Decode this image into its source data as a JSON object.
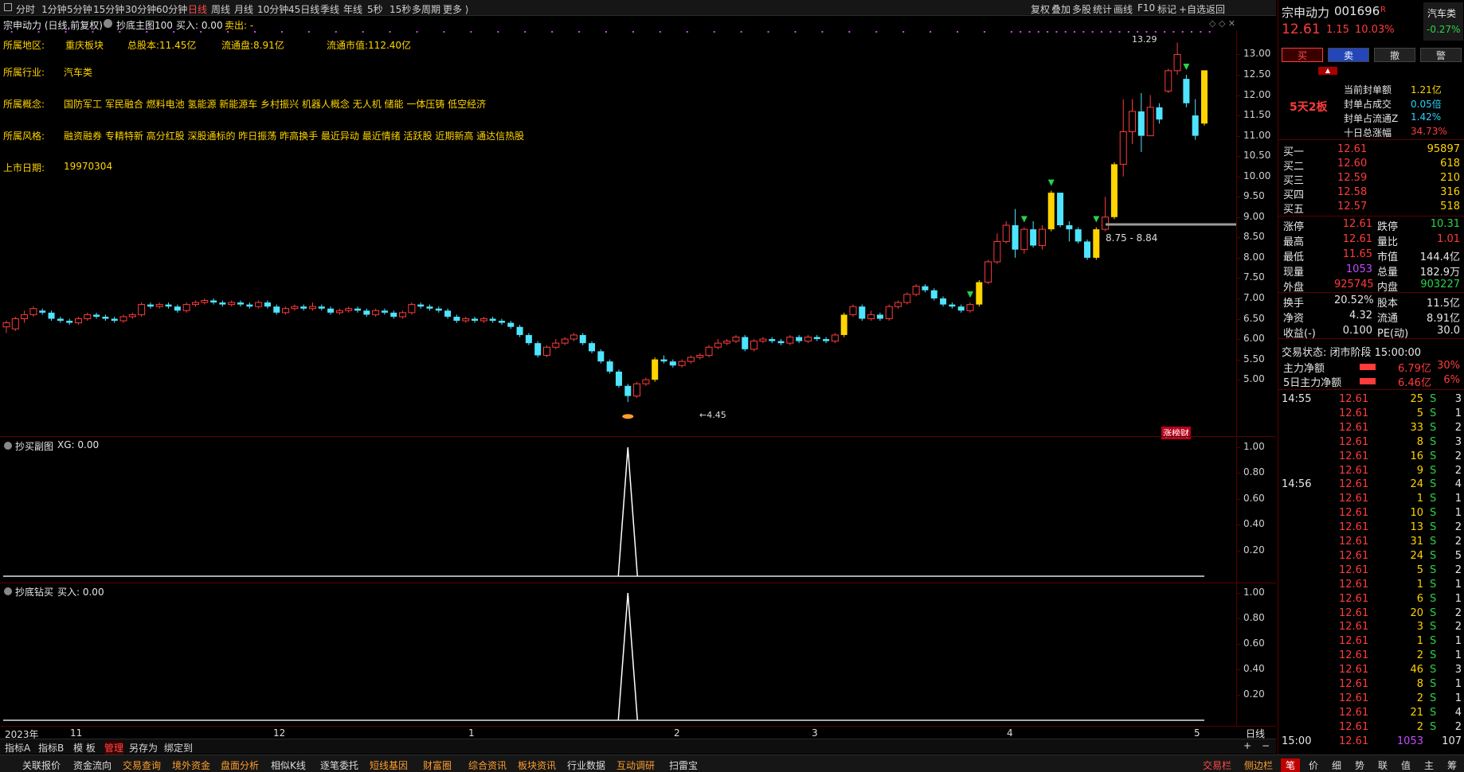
{
  "toolbar": {
    "items": [
      "分时",
      "1分钟",
      "5分钟",
      "15分钟",
      "30分钟",
      "60分钟",
      "日线",
      "周线",
      "月线",
      "10分钟",
      "45日线",
      "季线",
      "年线",
      "5秒",
      "15秒",
      "多周期",
      "更多 ⟩"
    ],
    "active": "日线",
    "right_items": [
      "复权",
      "叠加",
      "多股",
      "统计",
      "画线",
      "F10",
      "标记",
      "+自选",
      "返回"
    ]
  },
  "chart": {
    "title": "宗申动力 (日线,前复权)",
    "indicator_name": "抄底主图100",
    "buy_label": "买入: 0.00",
    "sell_label": "卖出: -",
    "info": {
      "region_label": "所属地区:",
      "region_value": "重庆板块",
      "total_share": "总股本:11.45亿",
      "float_share": "流通盘:8.91亿",
      "float_mcap": "流通市值:112.40亿",
      "industry_label": "所属行业:",
      "industry_value": "汽车类",
      "concept_label": "所属概念:",
      "concept_value": "国防军工 军民融合 燃料电池 氢能源 新能源车 乡村振兴 机器人概念 无人机 储能 一体压铸 低空经济",
      "style_label": "所属风格:",
      "style_value": "融资融券 专精特新 高分红股 深股通标的 昨日振荡 昨高换手 最近异动 最近情绪 活跃股 近期新高 通达信热股",
      "list_label": "上市日期:",
      "list_value": "19970304"
    },
    "y_ticks": [
      "13.00",
      "12.50",
      "12.00",
      "11.50",
      "11.00",
      "10.50",
      "10.00",
      "9.50",
      "9.00",
      "8.50",
      "8.00",
      "7.50",
      "7.00",
      "6.50",
      "6.00",
      "5.50",
      "5.00"
    ],
    "high_marker": "13.29",
    "low_marker": "←4.45",
    "range_label": "8.75 - 8.84",
    "badge": "涨榜财",
    "x_labels": [
      "2023年",
      "11",
      "12",
      "1",
      "2",
      "3",
      "4",
      "5"
    ],
    "period": "日线"
  },
  "chart_data": {
    "type": "candlestick",
    "ylim": [
      4.2,
      13.4
    ],
    "candles": [
      [
        6.3,
        6.4,
        6.15,
        6.45
      ],
      [
        6.25,
        6.5,
        6.2,
        6.55
      ],
      [
        6.5,
        6.6,
        6.4,
        6.7
      ],
      [
        6.6,
        6.75,
        6.55,
        6.8
      ],
      [
        6.7,
        6.65,
        6.6,
        6.75
      ],
      [
        6.65,
        6.5,
        6.45,
        6.7
      ],
      [
        6.5,
        6.45,
        6.4,
        6.55
      ],
      [
        6.45,
        6.4,
        6.35,
        6.5
      ],
      [
        6.4,
        6.5,
        6.35,
        6.55
      ],
      [
        6.5,
        6.6,
        6.45,
        6.65
      ],
      [
        6.6,
        6.55,
        6.5,
        6.65
      ],
      [
        6.55,
        6.5,
        6.45,
        6.6
      ],
      [
        6.5,
        6.45,
        6.4,
        6.55
      ],
      [
        6.45,
        6.55,
        6.4,
        6.6
      ],
      [
        6.55,
        6.6,
        6.5,
        6.65
      ],
      [
        6.6,
        6.85,
        6.55,
        6.9
      ],
      [
        6.85,
        6.8,
        6.75,
        6.9
      ],
      [
        6.8,
        6.85,
        6.75,
        6.9
      ],
      [
        6.85,
        6.8,
        6.75,
        6.9
      ],
      [
        6.8,
        6.7,
        6.65,
        6.85
      ],
      [
        6.7,
        6.85,
        6.65,
        6.9
      ],
      [
        6.85,
        6.9,
        6.8,
        6.95
      ],
      [
        6.9,
        6.95,
        6.85,
        7.0
      ],
      [
        6.95,
        6.9,
        6.85,
        7.0
      ],
      [
        6.9,
        6.85,
        6.8,
        6.95
      ],
      [
        6.85,
        6.9,
        6.8,
        6.95
      ],
      [
        6.9,
        6.85,
        6.8,
        6.95
      ],
      [
        6.85,
        6.8,
        6.75,
        6.9
      ],
      [
        6.8,
        6.9,
        6.75,
        6.95
      ],
      [
        6.9,
        6.8,
        6.75,
        6.95
      ],
      [
        6.8,
        6.65,
        6.6,
        6.85
      ],
      [
        6.65,
        6.75,
        6.6,
        6.8
      ],
      [
        6.75,
        6.8,
        6.7,
        6.85
      ],
      [
        6.8,
        6.75,
        6.7,
        6.85
      ],
      [
        6.75,
        6.8,
        6.7,
        6.9
      ],
      [
        6.8,
        6.75,
        6.7,
        6.85
      ],
      [
        6.75,
        6.65,
        6.6,
        6.8
      ],
      [
        6.65,
        6.7,
        6.6,
        6.75
      ],
      [
        6.7,
        6.75,
        6.65,
        6.8
      ],
      [
        6.75,
        6.7,
        6.65,
        6.8
      ],
      [
        6.7,
        6.6,
        6.55,
        6.75
      ],
      [
        6.6,
        6.7,
        6.55,
        6.75
      ],
      [
        6.7,
        6.65,
        6.6,
        6.75
      ],
      [
        6.65,
        6.55,
        6.5,
        6.7
      ],
      [
        6.55,
        6.65,
        6.5,
        6.7
      ],
      [
        6.65,
        6.85,
        6.6,
        6.9
      ],
      [
        6.85,
        6.8,
        6.75,
        6.9
      ],
      [
        6.8,
        6.75,
        6.7,
        6.85
      ],
      [
        6.75,
        6.7,
        6.65,
        6.8
      ],
      [
        6.7,
        6.55,
        6.5,
        6.75
      ],
      [
        6.55,
        6.45,
        6.4,
        6.6
      ],
      [
        6.45,
        6.5,
        6.4,
        6.55
      ],
      [
        6.5,
        6.45,
        6.4,
        6.55
      ],
      [
        6.45,
        6.5,
        6.4,
        6.55
      ],
      [
        6.5,
        6.45,
        6.4,
        6.55
      ],
      [
        6.45,
        6.4,
        6.35,
        6.5
      ],
      [
        6.4,
        6.3,
        6.25,
        6.45
      ],
      [
        6.3,
        6.1,
        6.05,
        6.35
      ],
      [
        6.1,
        5.9,
        5.85,
        6.15
      ],
      [
        5.9,
        5.6,
        5.55,
        5.95
      ],
      [
        5.6,
        5.8,
        5.55,
        5.85
      ],
      [
        5.8,
        5.9,
        5.75,
        6.0
      ],
      [
        5.9,
        6.0,
        5.85,
        6.05
      ],
      [
        6.0,
        6.1,
        5.95,
        6.15
      ],
      [
        6.1,
        5.9,
        5.85,
        6.15
      ],
      [
        5.9,
        5.7,
        5.65,
        5.95
      ],
      [
        5.7,
        5.45,
        5.4,
        5.75
      ],
      [
        5.45,
        5.2,
        5.15,
        5.5
      ],
      [
        5.2,
        4.85,
        4.8,
        5.25
      ],
      [
        4.85,
        4.6,
        4.45,
        4.9
      ],
      [
        4.6,
        4.9,
        4.55,
        4.95
      ],
      [
        4.9,
        5.0,
        4.85,
        5.05
      ],
      [
        5.0,
        5.5,
        4.95,
        5.55
      ],
      [
        5.5,
        5.45,
        5.4,
        5.6
      ],
      [
        5.45,
        5.35,
        5.3,
        5.5
      ],
      [
        5.35,
        5.45,
        5.3,
        5.5
      ],
      [
        5.45,
        5.55,
        5.4,
        5.6
      ],
      [
        5.55,
        5.6,
        5.5,
        5.65
      ],
      [
        5.6,
        5.8,
        5.55,
        5.85
      ],
      [
        5.8,
        5.9,
        5.75,
        6.0
      ],
      [
        5.9,
        5.95,
        5.85,
        6.0
      ],
      [
        5.95,
        6.05,
        5.9,
        6.1
      ],
      [
        6.05,
        5.75,
        5.7,
        6.1
      ],
      [
        5.75,
        5.95,
        5.7,
        6.0
      ],
      [
        5.95,
        6.0,
        5.9,
        6.05
      ],
      [
        6.0,
        5.95,
        5.9,
        6.05
      ],
      [
        5.95,
        5.9,
        5.85,
        6.0
      ],
      [
        5.9,
        6.05,
        5.85,
        6.1
      ],
      [
        6.05,
        5.95,
        5.9,
        6.1
      ],
      [
        5.95,
        6.05,
        5.9,
        6.1
      ],
      [
        6.05,
        6.0,
        5.95,
        6.1
      ],
      [
        6.0,
        5.95,
        5.9,
        6.05
      ],
      [
        5.95,
        6.1,
        5.9,
        6.15
      ],
      [
        6.1,
        6.6,
        6.05,
        6.65
      ],
      [
        6.6,
        6.8,
        6.55,
        6.85
      ],
      [
        6.8,
        6.5,
        6.45,
        6.85
      ],
      [
        6.5,
        6.6,
        6.45,
        6.7
      ],
      [
        6.6,
        6.5,
        6.45,
        6.65
      ],
      [
        6.5,
        6.8,
        6.45,
        6.85
      ],
      [
        6.8,
        6.9,
        6.75,
        6.95
      ],
      [
        6.9,
        7.1,
        6.85,
        7.15
      ],
      [
        7.1,
        7.3,
        7.05,
        7.35
      ],
      [
        7.3,
        7.2,
        7.15,
        7.35
      ],
      [
        7.2,
        7.0,
        6.95,
        7.25
      ],
      [
        7.0,
        6.85,
        6.8,
        7.05
      ],
      [
        6.85,
        6.8,
        6.75,
        6.9
      ],
      [
        6.8,
        6.7,
        6.65,
        6.85
      ],
      [
        6.7,
        6.85,
        6.65,
        6.9
      ],
      [
        6.85,
        7.4,
        6.8,
        7.45
      ],
      [
        7.4,
        7.9,
        7.35,
        7.95
      ],
      [
        7.9,
        8.4,
        7.85,
        8.6
      ],
      [
        8.4,
        8.8,
        8.35,
        8.9
      ],
      [
        8.8,
        8.2,
        8.0,
        9.2
      ],
      [
        8.2,
        8.7,
        8.1,
        8.75
      ],
      [
        8.7,
        8.3,
        8.25,
        8.9
      ],
      [
        8.3,
        8.7,
        8.2,
        8.8
      ],
      [
        8.7,
        9.6,
        8.65,
        9.65
      ],
      [
        9.6,
        8.8,
        8.75,
        9.25
      ],
      [
        8.8,
        8.7,
        8.4,
        8.9
      ],
      [
        8.7,
        8.4,
        8.35,
        8.75
      ],
      [
        8.4,
        8.0,
        7.95,
        8.45
      ],
      [
        8.0,
        8.7,
        7.95,
        8.75
      ],
      [
        8.7,
        9.0,
        8.65,
        9.5
      ],
      [
        9.0,
        10.3,
        8.95,
        10.35
      ],
      [
        10.3,
        11.1,
        10.0,
        11.9
      ],
      [
        11.1,
        11.6,
        10.8,
        11.9
      ],
      [
        11.6,
        11.0,
        10.6,
        12.05
      ],
      [
        11.0,
        11.7,
        11.0,
        12.0
      ],
      [
        11.7,
        11.4,
        11.3,
        11.8
      ],
      [
        12.1,
        12.6,
        12.05,
        12.65
      ],
      [
        12.6,
        13.0,
        12.5,
        13.29
      ],
      [
        12.4,
        11.8,
        11.7,
        12.5
      ],
      [
        11.5,
        11.0,
        10.9,
        11.9
      ],
      [
        11.3,
        12.61,
        11.25,
        12.61
      ]
    ]
  },
  "panel2": {
    "title": "抄买副图",
    "value": "XG: 0.00",
    "ticks": [
      "1.00",
      "0.80",
      "0.60",
      "0.40",
      "0.20"
    ]
  },
  "panel3": {
    "title": "抄底钻买",
    "value": "买入: 0.00",
    "ticks": [
      "1.00",
      "0.80",
      "0.60",
      "0.40",
      "0.20"
    ]
  },
  "tabs": {
    "items": [
      "指标A",
      "指标B",
      "模 板",
      "管理",
      "另存为",
      "绑定到"
    ],
    "active": "管理",
    "zoom_plus": "+",
    "zoom_minus": "−"
  },
  "bottom": {
    "items": [
      "关联报价",
      "资金流向",
      "交易查询",
      "境外资金",
      "盘面分析",
      "相似K线",
      "逐笔委托",
      "短线基因",
      "财富圈",
      "综合资讯",
      "板块资讯",
      "行业数据",
      "互动调研",
      "扫雷宝"
    ],
    "right": [
      "交易栏",
      "侧边栏"
    ]
  },
  "right": {
    "name": "宗申动力",
    "code": "001696",
    "tag": "R",
    "sector": "汽车类",
    "sector_pct": "-0.27%",
    "price": "12.61",
    "change": "1.15",
    "pct": "10.03%",
    "actions": [
      "买",
      "卖",
      "撤",
      "警"
    ],
    "board": "5天2板",
    "seal": [
      {
        "label": "当前封单额",
        "value": "1.21亿"
      },
      {
        "label": "封单占成交",
        "value": "0.05倍"
      },
      {
        "label": "封单占流通Z",
        "value": "1.42%"
      },
      {
        "label": "十日总涨幅",
        "value": "34.73%"
      }
    ],
    "bids": [
      {
        "name": "买一",
        "price": "12.61",
        "vol": "95897"
      },
      {
        "name": "买二",
        "price": "12.60",
        "vol": "618"
      },
      {
        "name": "买三",
        "price": "12.59",
        "vol": "210"
      },
      {
        "name": "买四",
        "price": "12.58",
        "vol": "316"
      },
      {
        "name": "买五",
        "price": "12.57",
        "vol": "518"
      }
    ],
    "stats": [
      [
        "涨停",
        "12.61",
        "跌停",
        "10.31"
      ],
      [
        "最高",
        "12.61",
        "量比",
        "1.01"
      ],
      [
        "最低",
        "11.65",
        "市值",
        "144.4亿"
      ],
      [
        "现量",
        "1053",
        "总量",
        "182.9万"
      ],
      [
        "外盘",
        "925745",
        "内盘",
        "903227"
      ]
    ],
    "stats2": [
      [
        "换手",
        "20.52%",
        "股本",
        "11.5亿"
      ],
      [
        "净资",
        "4.32",
        "流通",
        "8.91亿"
      ],
      [
        "收益(-)",
        "0.100",
        "PE(动)",
        "30.0"
      ]
    ],
    "status": "交易状态: 闭市阶段 15:00:00",
    "flows": [
      {
        "label": "主力净额",
        "value": "6.79亿",
        "pct": "30%"
      },
      {
        "label": "5日主力净额",
        "value": "6.46亿",
        "pct": "6%"
      }
    ],
    "trades": [
      {
        "t": "14:55",
        "p": "12.61",
        "v": "25",
        "s": "S",
        "n": "3"
      },
      {
        "t": "",
        "p": "12.61",
        "v": "5",
        "s": "S",
        "n": "1"
      },
      {
        "t": "",
        "p": "12.61",
        "v": "33",
        "s": "S",
        "n": "2"
      },
      {
        "t": "",
        "p": "12.61",
        "v": "8",
        "s": "S",
        "n": "3"
      },
      {
        "t": "",
        "p": "12.61",
        "v": "16",
        "s": "S",
        "n": "2"
      },
      {
        "t": "",
        "p": "12.61",
        "v": "9",
        "s": "S",
        "n": "2"
      },
      {
        "t": "14:56",
        "p": "12.61",
        "v": "24",
        "s": "S",
        "n": "4"
      },
      {
        "t": "",
        "p": "12.61",
        "v": "1",
        "s": "S",
        "n": "1"
      },
      {
        "t": "",
        "p": "12.61",
        "v": "10",
        "s": "S",
        "n": "1"
      },
      {
        "t": "",
        "p": "12.61",
        "v": "13",
        "s": "S",
        "n": "2"
      },
      {
        "t": "",
        "p": "12.61",
        "v": "31",
        "s": "S",
        "n": "2"
      },
      {
        "t": "",
        "p": "12.61",
        "v": "24",
        "s": "S",
        "n": "5"
      },
      {
        "t": "",
        "p": "12.61",
        "v": "5",
        "s": "S",
        "n": "2"
      },
      {
        "t": "",
        "p": "12.61",
        "v": "1",
        "s": "S",
        "n": "1"
      },
      {
        "t": "",
        "p": "12.61",
        "v": "6",
        "s": "S",
        "n": "1"
      },
      {
        "t": "",
        "p": "12.61",
        "v": "20",
        "s": "S",
        "n": "2"
      },
      {
        "t": "",
        "p": "12.61",
        "v": "3",
        "s": "S",
        "n": "2"
      },
      {
        "t": "",
        "p": "12.61",
        "v": "1",
        "s": "S",
        "n": "1"
      },
      {
        "t": "",
        "p": "12.61",
        "v": "2",
        "s": "S",
        "n": "1"
      },
      {
        "t": "",
        "p": "12.61",
        "v": "46",
        "s": "S",
        "n": "3"
      },
      {
        "t": "",
        "p": "12.61",
        "v": "8",
        "s": "S",
        "n": "1"
      },
      {
        "t": "",
        "p": "12.61",
        "v": "2",
        "s": "S",
        "n": "1"
      },
      {
        "t": "",
        "p": "12.61",
        "v": "21",
        "s": "S",
        "n": "4"
      },
      {
        "t": "",
        "p": "12.61",
        "v": "2",
        "s": "S",
        "n": "2"
      },
      {
        "t": "15:00",
        "p": "12.61",
        "v": "1053",
        "s": "",
        "n": "107"
      }
    ],
    "bottom_tabs": [
      "笔",
      "价",
      "细",
      "势",
      "联",
      "值",
      "主",
      "筹"
    ]
  },
  "colors": {
    "up": "#ff3b3b",
    "down": "#4fe4ff",
    "limit": "#ffd400",
    "grid": "#3a0000"
  }
}
